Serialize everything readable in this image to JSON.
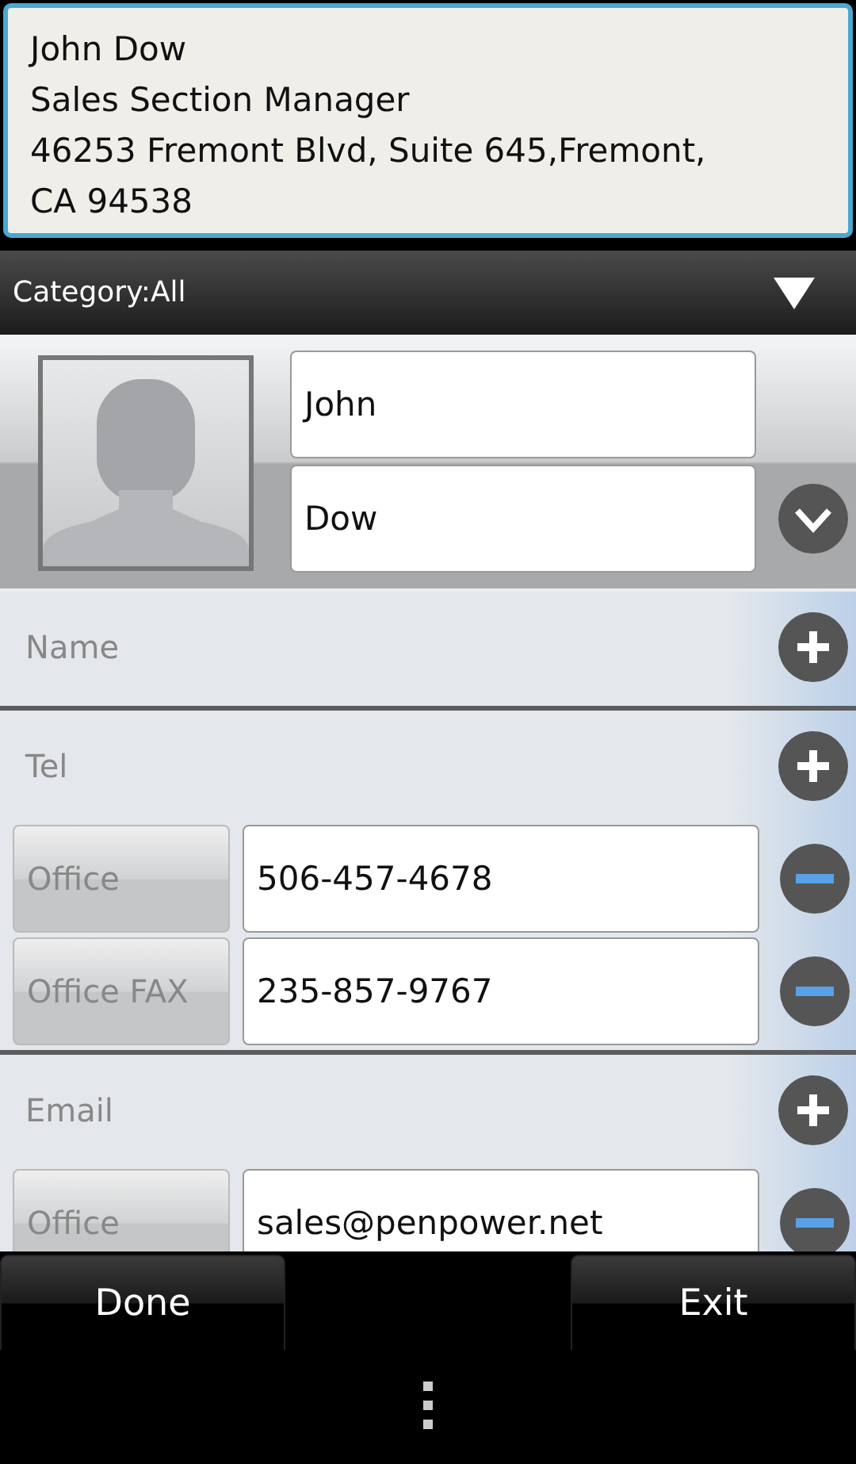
{
  "card": {
    "lines": [
      "John Dow",
      "Sales Section Manager",
      "46253 Fremont Blvd, Suite 645,Fremont,",
      "CA 94538"
    ]
  },
  "category": {
    "label": "Category:All"
  },
  "name_fields": [
    {
      "value": "John"
    },
    {
      "value": "Dow"
    }
  ],
  "sections": [
    {
      "label": "Name"
    },
    {
      "label": "Tel",
      "rows": [
        {
          "type": "Office",
          "value": "506-457-4678"
        },
        {
          "type": "Office FAX",
          "value": "235-857-9767"
        }
      ]
    },
    {
      "label": "Email",
      "rows": [
        {
          "type": "Office",
          "value": "sales@penpower.net"
        }
      ]
    }
  ],
  "buttons": [
    {
      "label": "Done"
    },
    {
      "label": "Exit"
    }
  ]
}
